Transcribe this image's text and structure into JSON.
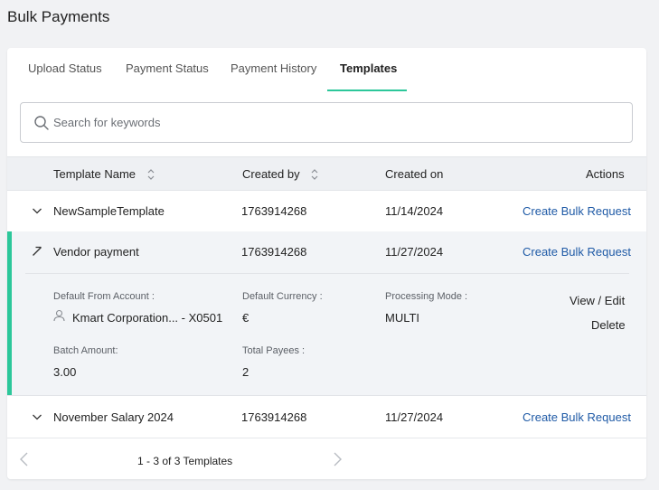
{
  "page": {
    "title": "Bulk Payments"
  },
  "tabs": [
    {
      "label": "Upload Status"
    },
    {
      "label": "Payment Status"
    },
    {
      "label": "Payment History"
    },
    {
      "label": "Templates"
    }
  ],
  "search": {
    "placeholder": "Search for keywords",
    "value": ""
  },
  "table": {
    "columns": {
      "template_name": "Template Name",
      "created_by": "Created by",
      "created_on": "Created on",
      "actions": "Actions"
    },
    "rows": [
      {
        "name": "NewSampleTemplate",
        "created_by": "1763914268",
        "created_on": "11/14/2024",
        "action": "Create Bulk Request"
      },
      {
        "name": "Vendor payment",
        "created_by": "1763914268",
        "created_on": "11/27/2024",
        "action": "Create Bulk Request"
      },
      {
        "name": "November Salary 2024",
        "created_by": "1763914268",
        "created_on": "11/27/2024",
        "action": "Create Bulk Request"
      }
    ]
  },
  "details": {
    "default_from_account_label": "Default From Account :",
    "default_from_account_value": "Kmart Corporation... - X0501",
    "default_currency_label": "Default Currency :",
    "default_currency_value": "€",
    "processing_mode_label": "Processing Mode :",
    "processing_mode_value": "MULTI",
    "batch_amount_label": "Batch Amount:",
    "batch_amount_value": "3.00",
    "total_payees_label": "Total Payees :",
    "total_payees_value": "2",
    "view_edit_label": "View / Edit",
    "delete_label": "Delete"
  },
  "pagination": {
    "text": "1 - 3 of 3 Templates"
  },
  "colors": {
    "accent": "#2cc79a",
    "link": "#1f5aa6"
  }
}
